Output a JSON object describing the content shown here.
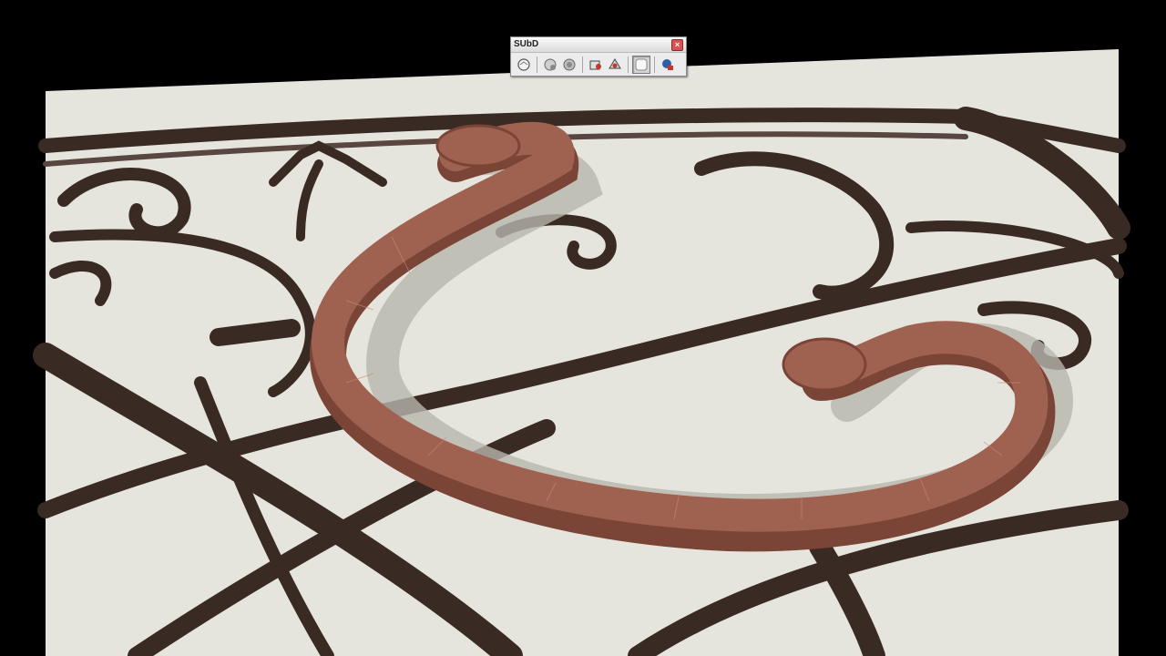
{
  "toolbar": {
    "title": "SUbD",
    "close_label": "×",
    "buttons": [
      {
        "icon": "subd-create-icon"
      },
      {
        "icon": "subd-refine-icon"
      },
      {
        "icon": "subd-crease-icon"
      },
      {
        "icon": "subd-convert-icon"
      },
      {
        "icon": "subd-attach-icon"
      },
      {
        "icon": "subd-smooth-preview-icon",
        "pressed": true
      },
      {
        "icon": "subd-settings-icon"
      }
    ]
  },
  "scene": {
    "background_color": "#000000",
    "ground_color": "#e5e5dd",
    "ironwork_color": "#3a2a24",
    "model_color": "#a06250",
    "model_shadow_color": "#7a4536"
  }
}
